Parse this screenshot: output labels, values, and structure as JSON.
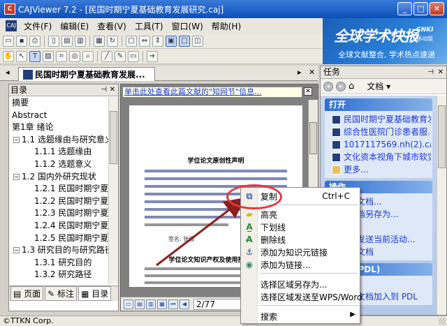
{
  "window": {
    "title": "CAJViewer 7.2 - [民国时期宁夏基础教育发展研究.caj]",
    "app_icon": "caj-app-icon"
  },
  "menubar": {
    "items": [
      "文件(F)",
      "编辑(E)",
      "查看(V)",
      "工具(T)",
      "窗口(W)",
      "帮助(H)"
    ]
  },
  "banner": {
    "main": "全球学术快报",
    "brand": "CNKI",
    "brand_sub": "移动版",
    "tagline": "全球文献整合, 学术热点速递"
  },
  "doc_tab": {
    "label": "民国时期宁夏基础教育发展..."
  },
  "left_panel": {
    "header": "目录",
    "toc": [
      {
        "label": "摘要",
        "indent": 0,
        "expander": ""
      },
      {
        "label": "Abstract",
        "indent": 0,
        "expander": ""
      },
      {
        "label": "第1章 绪论",
        "indent": 0,
        "expander": ""
      },
      {
        "label": "1.1 选题缘由与研究意义",
        "indent": 1,
        "expander": "-"
      },
      {
        "label": "1.1.1 选题缘由",
        "indent": 2,
        "expander": ""
      },
      {
        "label": "1.1.2 选题意义",
        "indent": 2,
        "expander": ""
      },
      {
        "label": "1.2 国内外研究现状",
        "indent": 1,
        "expander": "-"
      },
      {
        "label": "1.2.1 民国时期宁夏者",
        "indent": 2,
        "expander": ""
      },
      {
        "label": "1.2.2 民国时期宁夏边",
        "indent": 2,
        "expander": ""
      },
      {
        "label": "1.2.3 民国时期宁夏国",
        "indent": 2,
        "expander": ""
      },
      {
        "label": "1.2.4 民国时期宁夏参",
        "indent": 2,
        "expander": ""
      },
      {
        "label": "1.2.5 民国时期宁夏各",
        "indent": 2,
        "expander": ""
      },
      {
        "label": "1.3 研究目的与研究路径",
        "indent": 1,
        "expander": "-"
      },
      {
        "label": "1.3.1 研究目的",
        "indent": 2,
        "expander": ""
      },
      {
        "label": "1.3.2 研究路径",
        "indent": 2,
        "expander": ""
      }
    ],
    "tabs": [
      "页面",
      "标注",
      "目录"
    ]
  },
  "doc": {
    "info_link": "单击此处查看此篇文献的\"知网节\"信息...",
    "page_title_1": "学位论文原创性声明",
    "page_title_2": "学位论文知识产权及使用授权声明",
    "signature": "签名: 张倩",
    "page_indicator": "2/77"
  },
  "right_panel": {
    "header": "任务",
    "dropdown": "文档",
    "sections": [
      {
        "title": "打开",
        "items": [
          {
            "label": "民国时期宁夏基础教育发",
            "icon": "caj-file"
          },
          {
            "label": "综合性医院门诊患者服...",
            "icon": "caj-file"
          },
          {
            "label": "1017117569.nh(2).caj",
            "icon": "caj-file"
          },
          {
            "label": "文化资本视角下城市软实...",
            "icon": "caj-file"
          },
          {
            "label": "更多...",
            "icon": "folder"
          }
        ]
      },
      {
        "title": "操作",
        "items": [
          {
            "label": "前活动文档...",
            "icon": ""
          },
          {
            "label": "活动文档另存为...",
            "icon": ""
          },
          {
            "label": "",
            "icon": ""
          },
          {
            "label": "件方式发送当前活动...",
            "icon": ""
          },
          {
            "label": "前活动文档",
            "icon": ""
          }
        ]
      },
      {
        "title": "图书馆(PDL)",
        "items": [
          {
            "label": "PDL",
            "icon": ""
          },
          {
            "label": "前活动文档加入到 PDL",
            "icon": ""
          }
        ]
      }
    ]
  },
  "context_menu": {
    "items": [
      {
        "label": "复制",
        "shortcut": "Ctrl+C",
        "icon": "copy-icon",
        "submenu": false
      },
      {
        "label": "高亮",
        "shortcut": "",
        "icon": "highlight-icon",
        "submenu": false
      },
      {
        "label": "下划线",
        "shortcut": "",
        "icon": "underline-icon",
        "submenu": false
      },
      {
        "label": "删除线",
        "shortcut": "",
        "icon": "strikethrough-icon",
        "submenu": false
      },
      {
        "label": "添加为知识元链接",
        "shortcut": "",
        "icon": "anchor-icon",
        "submenu": false
      },
      {
        "label": "添加为链接...",
        "shortcut": "",
        "icon": "link-icon",
        "submenu": false
      },
      {
        "label": "选择区域另存为...",
        "shortcut": "",
        "icon": "",
        "submenu": false
      },
      {
        "label": "选择区域发送至WPS/Word",
        "shortcut": "",
        "icon": "",
        "submenu": false
      },
      {
        "label": "搜索",
        "shortcut": "",
        "icon": "",
        "submenu": true
      }
    ]
  },
  "statusbar": {
    "text": "©TTKN Corp."
  },
  "colors": {
    "title_bar": "#0c4fb8",
    "highlight_circle": "#e03a3a",
    "arrow": "#8b1e1e",
    "link": "#1a3ad0"
  }
}
